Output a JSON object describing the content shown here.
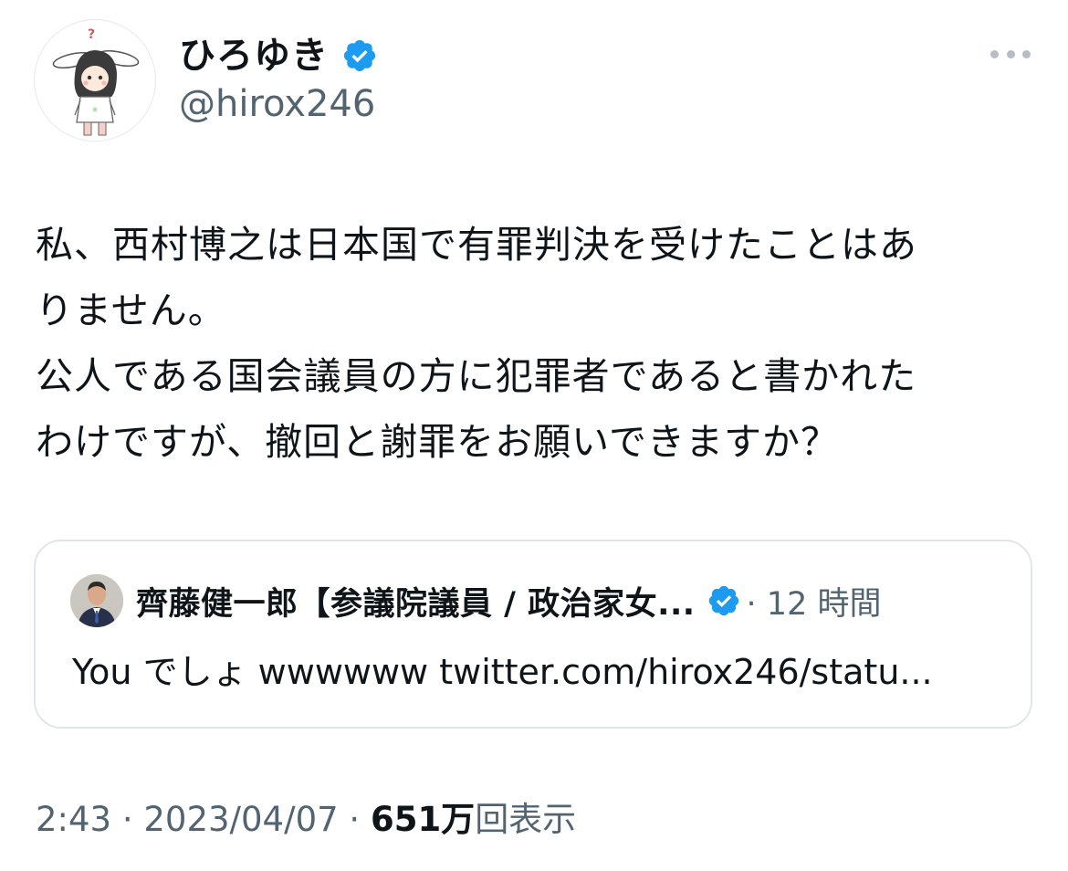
{
  "author": {
    "display_name": "ひろゆき",
    "handle": "@hirox246",
    "avatar_icon": "character-avatar-icon",
    "verified_icon": "verified-badge-icon"
  },
  "tweet": {
    "text_lines": [
      "私、西村博之は日本国で有罪判決を受けたことはあ",
      "りません。",
      "公人である国会議員の方に犯罪者であると書かれた",
      "わけですが、撤回と謝罪をお願いできますか？"
    ]
  },
  "quote": {
    "author_name": "齊藤健一郎【参議院議員 / 政治家女...",
    "time": "· 12 時間",
    "text": "You でしょ wwwwww twitter.com/hirox246/statu..."
  },
  "meta": {
    "time": "2:43",
    "separator": " · ",
    "date": "2023/04/07",
    "separator2": " · ",
    "views_count": "651万",
    "views_label": "回表示"
  },
  "colors": {
    "verified": "#1d9bf0",
    "secondary_text": "#536471",
    "primary_text": "#0f1419",
    "border": "#e1e6ea"
  }
}
